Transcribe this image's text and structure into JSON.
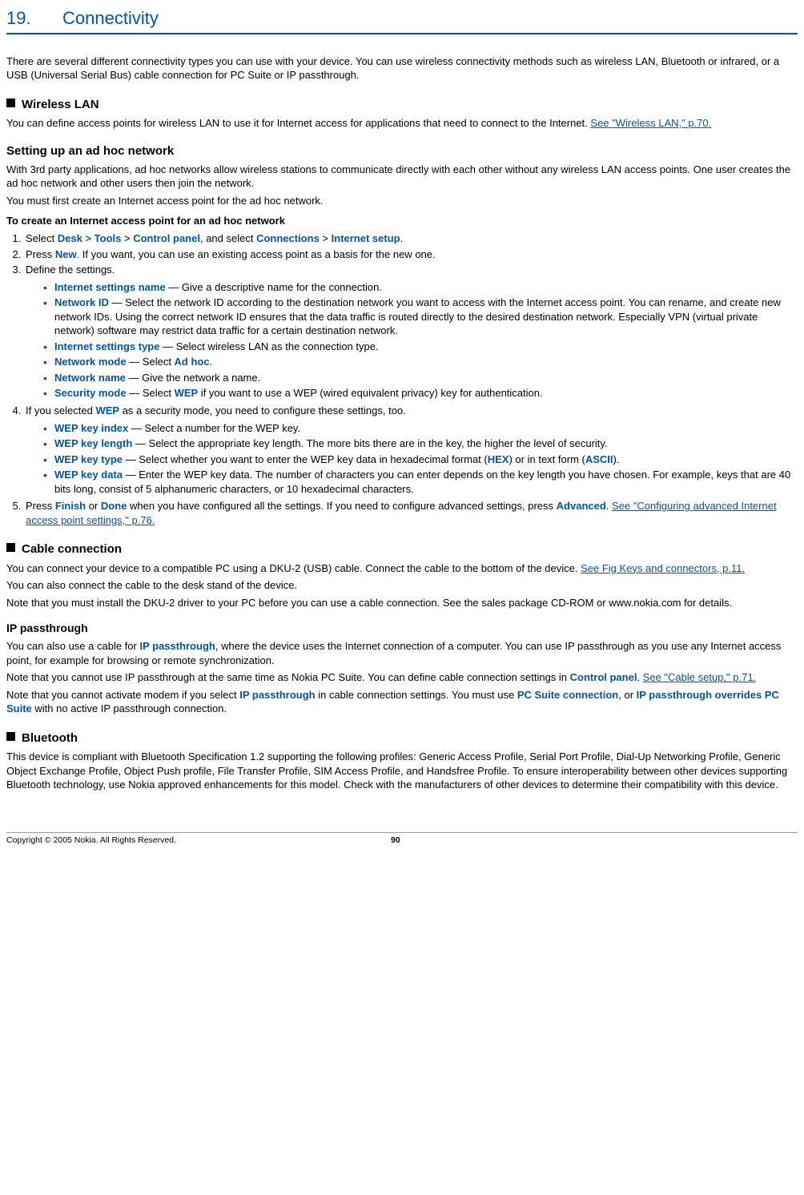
{
  "chapter": {
    "number": "19.",
    "title": "Connectivity"
  },
  "intro": "There are several different connectivity types you can use with your device. You can use wireless connectivity methods such as wireless LAN, Bluetooth or infrared, or a USB (Universal Serial Bus) cable connection for PC Suite or IP passthrough.",
  "wlan": {
    "heading": "Wireless LAN",
    "p1a": "You can define access points for wireless LAN to use it for Internet access for applications that need to connect to the Internet.",
    "link1": "See \"Wireless LAN,\" p.70.",
    "adhoc_heading": "Setting up an ad hoc network",
    "p2": "With 3rd party applications, ad hoc networks allow wireless stations to communicate directly with each other without any wireless LAN access points. One user creates the ad hoc network and other users then join the network.",
    "p3": "You must first create an Internet access point for the ad hoc network.",
    "procedure_title": "To create an Internet access point for an ad hoc network",
    "step1": {
      "pre": "Select ",
      "desk": "Desk",
      "gt1": " > ",
      "tools": "Tools",
      "gt2": " > ",
      "cp": "Control panel",
      "mid": ", and select ",
      "conn": "Connections",
      "gt3": " > ",
      "is": "Internet setup",
      "end": "."
    },
    "step2": {
      "pre": "Press ",
      "new": "New",
      "rest": ". If you want, you can use an existing access point as a basis for the new one."
    },
    "step3": "Define the settings.",
    "b1": {
      "label": "Internet settings name",
      "text": " —  Give a descriptive name for the connection."
    },
    "b2": {
      "label": "Network ID",
      "text": " —  Select the network ID according to the destination network you want to access with the Internet access point. You can rename, and create new network IDs. Using the correct network ID ensures that the data traffic is routed directly to the desired destination network. Especially VPN (virtual private network) software may restrict data traffic for a certain destination network."
    },
    "b3": {
      "label": "Internet settings type",
      "text": " —  Select wireless LAN as the connection type."
    },
    "b4": {
      "label": "Network mode",
      "pre": " —  Select ",
      "val": "Ad hoc",
      "end": "."
    },
    "b5": {
      "label": "Network name",
      "text": " —  Give the network a name."
    },
    "b6": {
      "label": "Security mode",
      "pre": " —  Select ",
      "val": "WEP",
      "rest": " if you want to use a WEP (wired equivalent privacy) key for authentication."
    },
    "step4": {
      "pre": "If you selected ",
      "val": "WEP",
      "rest": " as a security mode, you need to configure these settings, too."
    },
    "c1": {
      "label": "WEP key index",
      "text": " —  Select a number for the WEP key."
    },
    "c2": {
      "label": "WEP key length",
      "text": " —  Select the appropriate key length. The more bits there are in the key, the higher the level of security."
    },
    "c3": {
      "label": "WEP key type",
      "pre": " —  Select whether you want to enter the WEP key data in hexadecimal format (",
      "hex": "HEX",
      "mid": ") or in text form (",
      "ascii": "ASCII",
      "end": ")."
    },
    "c4": {
      "label": "WEP key data",
      "text": " —  Enter the WEP key data. The number of characters you can enter depends on the key length you have chosen. For example, keys that are 40 bits long, consist of 5 alphanumeric characters, or 10 hexadecimal characters."
    },
    "step5": {
      "pre": "Press ",
      "finish": "Finish",
      "or": " or ",
      "done": "Done",
      "mid": " when you have configured all the settings. If you need to configure advanced settings, press ",
      "adv": "Advanced",
      "dot": ". ",
      "link": "See \"Configuring advanced Internet access point settings,\" p.76."
    }
  },
  "cable": {
    "heading": "Cable connection",
    "p1a": "You can connect your device to a compatible PC using a DKU-2 (USB) cable. Connect the cable to the bottom of the device. ",
    "link1": "See Fig Keys and connectors, p.11.",
    "p2": "You can also connect the cable to the desk stand of the device.",
    "p3": "Note that you must install the DKU-2 driver to your PC before you can use a cable connection. See the sales package CD-ROM or www.nokia.com for details."
  },
  "ipp": {
    "heading": "IP passthrough",
    "p1a": "You can also use a cable for ",
    "p1b": "IP passthrough",
    "p1c": ", where the device uses the Internet connection of a computer. You can use IP passthrough as you use any Internet access point, for example for browsing or remote synchronization.",
    "p2a": "Note that you cannot use IP passthrough at the same time as Nokia PC Suite. You can define cable connection settings in ",
    "p2b": "Control panel",
    "p2c": ". ",
    "link": "See \"Cable setup,\" p.71.",
    "p3a": "Note that you cannot activate modem if you select ",
    "p3b": "IP passthrough",
    "p3c": " in cable connection settings. You must use ",
    "p3d": "PC Suite connection",
    "p3e": ", or ",
    "p3f": "IP passthrough overrides PC Suite",
    "p3g": " with no active IP passthrough connection."
  },
  "bt": {
    "heading": "Bluetooth",
    "p1": "This device is compliant with Bluetooth Specification 1.2 supporting the following profiles: Generic Access Profile, Serial Port Profile, Dial-Up Networking Profile, Generic Object Exchange Profile, Object Push profile, File Transfer Profile, SIM Access Profile, and Handsfree Profile. To ensure interoperability between other devices supporting Bluetooth technology, use Nokia approved enhancements for this model. Check with the manufacturers of other devices to determine their compatibility with this device."
  },
  "footer": {
    "copyright": "Copyright © 2005 Nokia. All Rights Reserved.",
    "page": "90"
  }
}
